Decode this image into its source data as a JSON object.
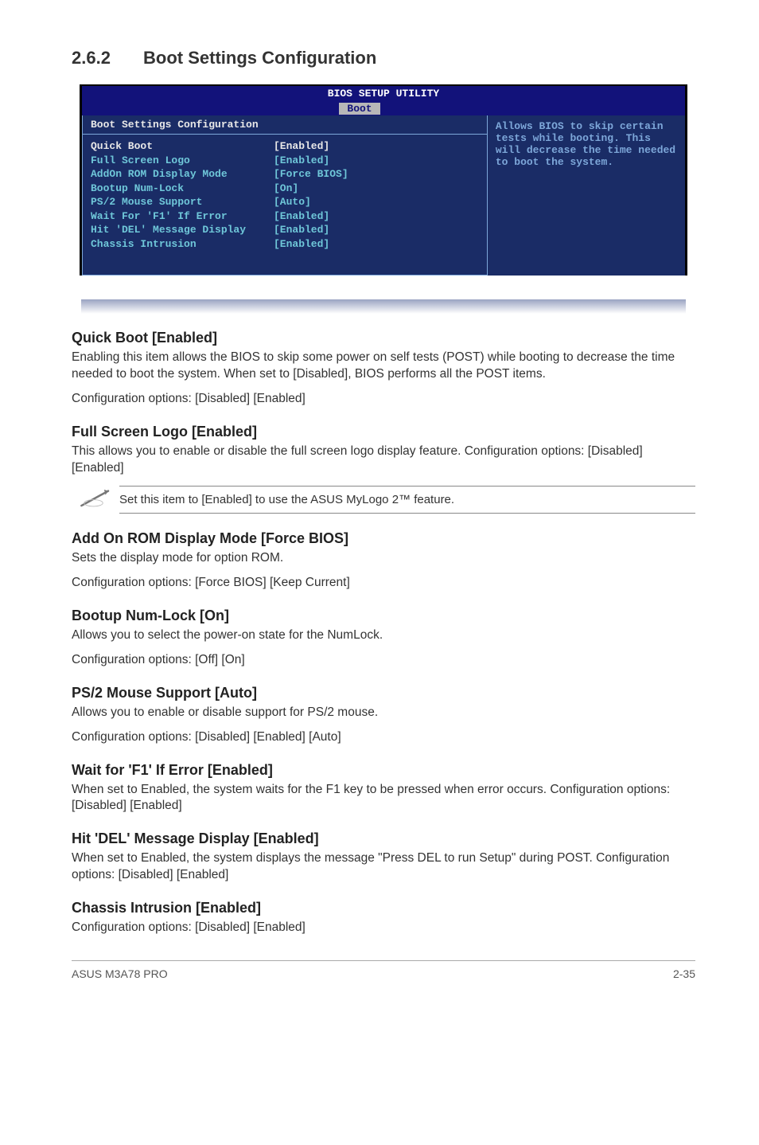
{
  "section": {
    "number": "2.6.2",
    "title": "Boot Settings Configuration"
  },
  "bios": {
    "header": "BIOS SETUP UTILITY",
    "tab": "Boot",
    "panel_title": "Boot Settings Configuration",
    "rows": [
      {
        "label": "Quick Boot",
        "value": "[Enabled]",
        "hl": true
      },
      {
        "label": "Full Screen Logo",
        "value": "[Enabled]",
        "hl": false
      },
      {
        "label": "AddOn ROM Display Mode",
        "value": "[Force BIOS]",
        "hl": false
      },
      {
        "label": "Bootup Num-Lock",
        "value": "[On]",
        "hl": false
      },
      {
        "label": "PS/2 Mouse Support",
        "value": "[Auto]",
        "hl": false
      },
      {
        "label": "Wait For 'F1' If Error",
        "value": "[Enabled]",
        "hl": false
      },
      {
        "label": "Hit 'DEL' Message Display",
        "value": "[Enabled]",
        "hl": false
      },
      {
        "label": "Chassis Intrusion",
        "value": "[Enabled]",
        "hl": false
      }
    ],
    "help": "Allows BIOS to skip certain tests while booting. This will decrease the time needed to boot the system."
  },
  "items": {
    "quick_boot": {
      "title": "Quick Boot [Enabled]",
      "p1": "Enabling this item allows the BIOS to skip some power on self tests (POST) while booting to decrease the time needed to boot the system. When set to [Disabled], BIOS performs all the POST items.",
      "p2": "Configuration options: [Disabled] [Enabled]"
    },
    "full_screen_logo": {
      "title": "Full Screen Logo [Enabled]",
      "p1": "This allows you to enable or disable the full screen logo display feature. Configuration options: [Disabled] [Enabled]"
    },
    "note": "Set this item to [Enabled] to use the ASUS MyLogo 2™ feature.",
    "addon_rom": {
      "title": "Add On ROM Display Mode [Force BIOS]",
      "p1": "Sets the display mode for option ROM.",
      "p2": "Configuration options: [Force BIOS] [Keep Current]"
    },
    "bootup_numlock": {
      "title": "Bootup Num-Lock [On]",
      "p1": "Allows you to select the power-on state for the NumLock.",
      "p2": "Configuration options: [Off] [On]"
    },
    "ps2_mouse": {
      "title": "PS/2 Mouse Support [Auto]",
      "p1": "Allows you to enable or disable support for PS/2 mouse.",
      "p2": "Configuration options: [Disabled] [Enabled] [Auto]"
    },
    "wait_f1": {
      "title": "Wait for 'F1' If Error [Enabled]",
      "p1": "When set to Enabled, the system waits for the F1 key to be pressed when error occurs. Configuration options: [Disabled] [Enabled]"
    },
    "hit_del": {
      "title": "Hit 'DEL' Message Display [Enabled]",
      "p1": "When set to Enabled, the system displays the message \"Press DEL to run Setup\" during POST. Configuration options: [Disabled] [Enabled]"
    },
    "chassis": {
      "title": "Chassis Intrusion [Enabled]",
      "p1": "Configuration options: [Disabled] [Enabled]"
    }
  },
  "footer": {
    "left": "ASUS M3A78 PRO",
    "right": "2-35"
  }
}
